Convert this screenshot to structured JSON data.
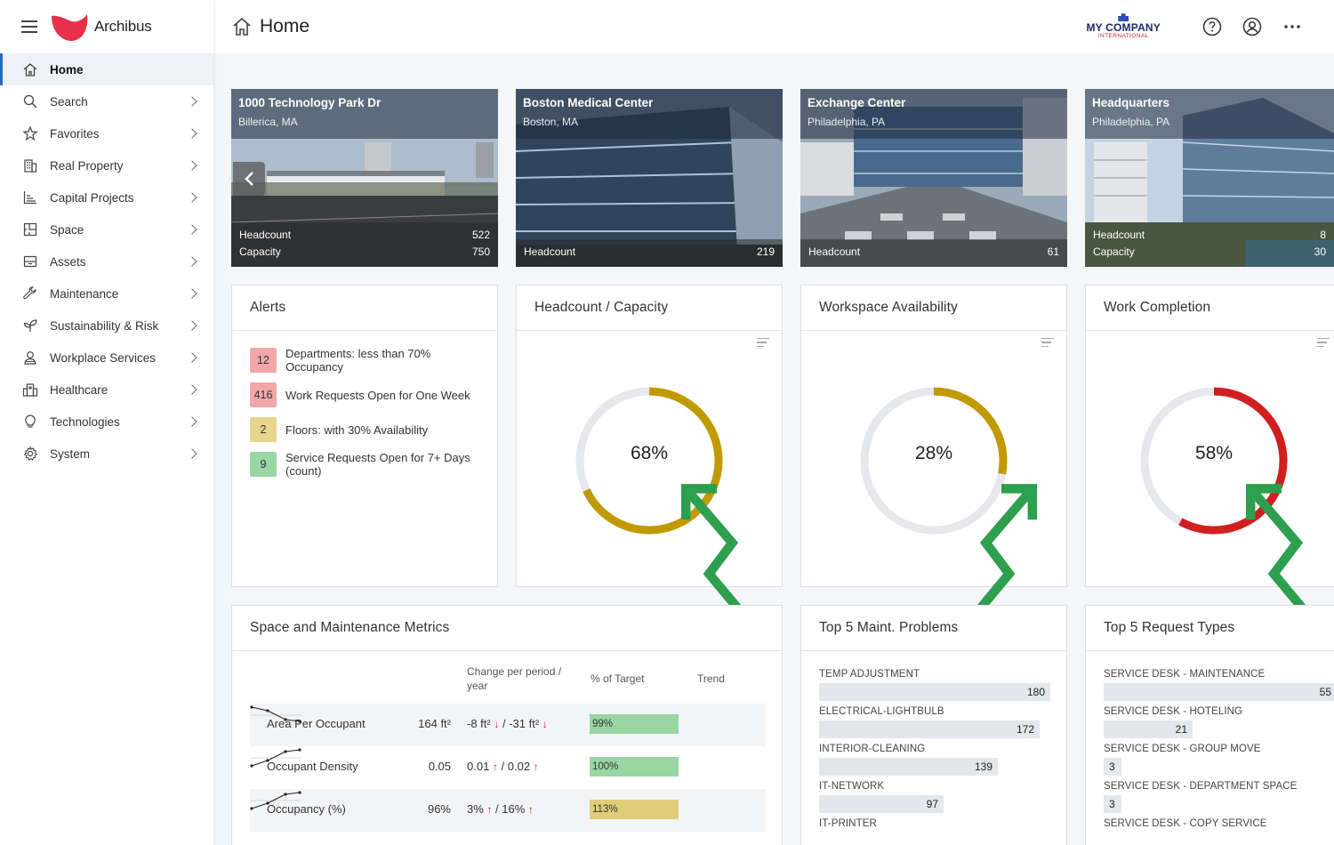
{
  "brand": {
    "name": "Archibus"
  },
  "header": {
    "title": "Home",
    "company_top": "MY COMPANY",
    "company_bottom": "INTERNATIONAL"
  },
  "sidebar": {
    "items": [
      {
        "label": "Home",
        "icon": "home-icon",
        "active": true
      },
      {
        "label": "Search",
        "icon": "search-icon"
      },
      {
        "label": "Favorites",
        "icon": "star-icon"
      },
      {
        "label": "Real Property",
        "icon": "building-icon"
      },
      {
        "label": "Capital Projects",
        "icon": "chart-icon"
      },
      {
        "label": "Space",
        "icon": "floorplan-icon"
      },
      {
        "label": "Assets",
        "icon": "assets-icon"
      },
      {
        "label": "Maintenance",
        "icon": "wrench-icon"
      },
      {
        "label": "Sustainability & Risk",
        "icon": "leaf-icon"
      },
      {
        "label": "Workplace Services",
        "icon": "person-icon"
      },
      {
        "label": "Healthcare",
        "icon": "hospital-icon"
      },
      {
        "label": "Technologies",
        "icon": "lightbulb-icon"
      },
      {
        "label": "System",
        "icon": "gear-icon"
      }
    ]
  },
  "properties": [
    {
      "name": "1000 Technology Park Dr",
      "location": "Billerica, MA",
      "headcount_label": "Headcount",
      "headcount": "522",
      "capacity_label": "Capacity",
      "capacity": "750"
    },
    {
      "name": "Boston Medical Center",
      "location": "Boston, MA",
      "headcount_label": "Headcount",
      "headcount": "219"
    },
    {
      "name": "Exchange Center",
      "location": "Philadelphia, PA",
      "headcount_label": "Headcount",
      "headcount": "61"
    },
    {
      "name": "Headquarters",
      "location": "Philadelphia, PA",
      "headcount_label": "Headcount",
      "headcount": "8",
      "capacity_label": "Capacity",
      "capacity": "30"
    }
  ],
  "alerts": {
    "title": "Alerts",
    "items": [
      {
        "count": "12",
        "text": "Departments: less than 70% Occupancy",
        "color": "#f2a8a8"
      },
      {
        "count": "416",
        "text": "Work Requests Open for One Week",
        "color": "#f2a8a8"
      },
      {
        "count": "2",
        "text": "Floors: with 30% Availability",
        "color": "#e8d68a"
      },
      {
        "count": "9",
        "text": "Service Requests Open for 7+ Days (count)",
        "color": "#98d6a4"
      }
    ]
  },
  "gauges": [
    {
      "title": "Headcount / Capacity",
      "value_text": "68%",
      "value": 68,
      "color": "#c19a00",
      "trend": "up"
    },
    {
      "title": "Workspace Availability",
      "value_text": "28%",
      "value": 28,
      "color": "#c19a00",
      "trend": "down"
    },
    {
      "title": "Work Completion",
      "value_text": "58%",
      "value": 58,
      "color": "#d11f1f",
      "trend": "up"
    }
  ],
  "metrics": {
    "title": "Space and Maintenance Metrics",
    "col_change": "Change per period / year",
    "col_target": "% of Target",
    "col_trend": "Trend",
    "rows": [
      {
        "label": "Area Per Occupant",
        "value": "164 ft²",
        "change_period": "-8 ft²",
        "period_dir": "down",
        "change_year": "-31 ft²",
        "year_dir": "down",
        "target": "99%",
        "target_pct": 99,
        "bar_color": "#98d6a4",
        "trend": "down"
      },
      {
        "label": "Occupant Density",
        "value": "0.05",
        "change_period": "0.01",
        "period_dir": "up",
        "change_year": "0.02",
        "year_dir": "up",
        "target": "100%",
        "target_pct": 100,
        "bar_color": "#98d6a4",
        "trend": "up"
      },
      {
        "label": "Occupancy (%)",
        "value": "96%",
        "change_period": "3%",
        "period_dir": "up",
        "change_year": "16%",
        "year_dir": "up",
        "target": "113%",
        "target_pct": 113,
        "bar_color": "#e0cd7a",
        "trend": "up"
      }
    ]
  },
  "maint_problems": {
    "title": "Top 5 Maint. Problems",
    "items": [
      {
        "label": "TEMP ADJUSTMENT",
        "value": 180
      },
      {
        "label": "ELECTRICAL-LIGHTBULB",
        "value": 172
      },
      {
        "label": "INTERIOR-CLEANING",
        "value": 139
      },
      {
        "label": "IT-NETWORK",
        "value": 97
      },
      {
        "label": "IT-PRINTER",
        "value": null
      }
    ]
  },
  "request_types": {
    "title": "Top 5 Request Types",
    "items": [
      {
        "label": "SERVICE DESK - MAINTENANCE",
        "value": 55
      },
      {
        "label": "SERVICE DESK - HOTELING",
        "value": 21
      },
      {
        "label": "SERVICE DESK - GROUP MOVE",
        "value": 3
      },
      {
        "label": "SERVICE DESK - DEPARTMENT SPACE",
        "value": 3
      },
      {
        "label": "SERVICE DESK - COPY SERVICE",
        "value": null
      }
    ]
  }
}
